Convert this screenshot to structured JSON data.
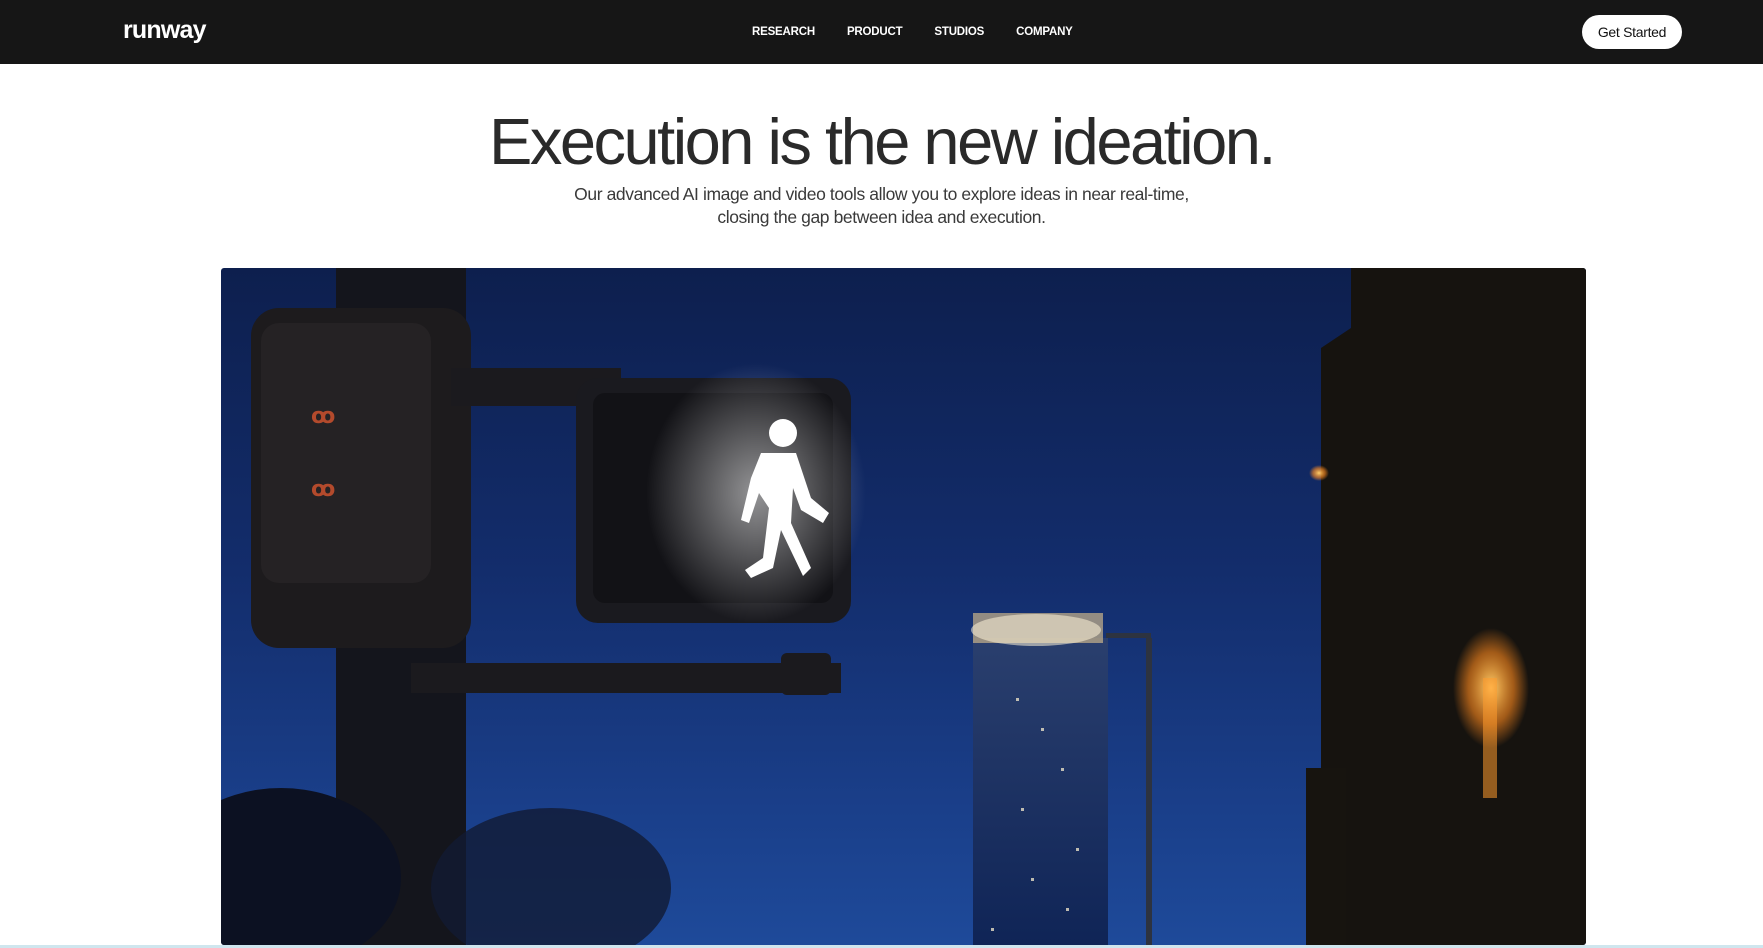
{
  "brand": {
    "logo_text": "runway"
  },
  "nav": {
    "links": [
      "RESEARCH",
      "PRODUCT",
      "STUDIOS",
      "COMPANY"
    ],
    "cta_label": "Get Started"
  },
  "hero": {
    "title": "Execution is the new ideation.",
    "subtitle_line1": "Our advanced AI image and video tools allow you to explore ideas in near real-time,",
    "subtitle_line2": "closing the gap between idea and execution."
  },
  "media": {
    "description_icon": "walk-signal-video",
    "colors": {
      "sky": "#1a3f8a",
      "night": "#0d1f4e",
      "signal": "#ffffff",
      "lamp": "#ff9a2e"
    }
  }
}
